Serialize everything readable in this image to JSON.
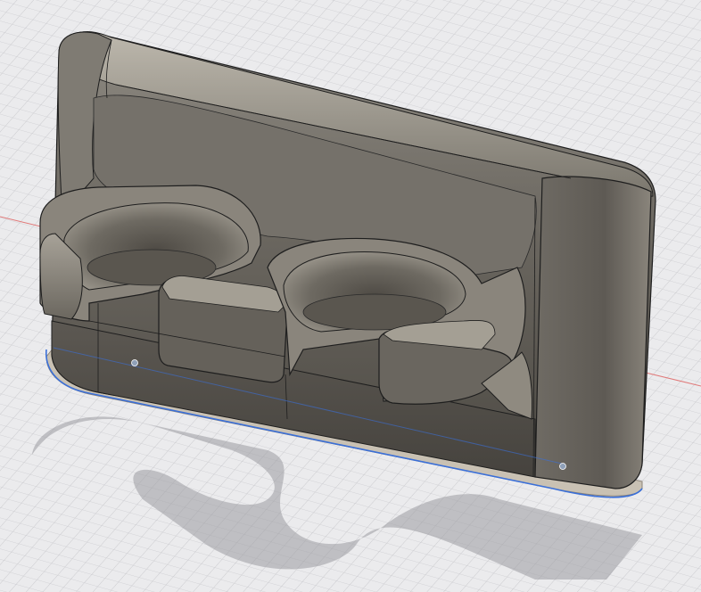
{
  "viewport": {
    "background_color": "#ebebed",
    "grid_color": "#c9c9cd",
    "x_axis_color": "#e07a7a",
    "model_color": "#6e6a63",
    "sketch_outline_color": "#3a6fd8",
    "edge_color": "#1e1e1e"
  }
}
